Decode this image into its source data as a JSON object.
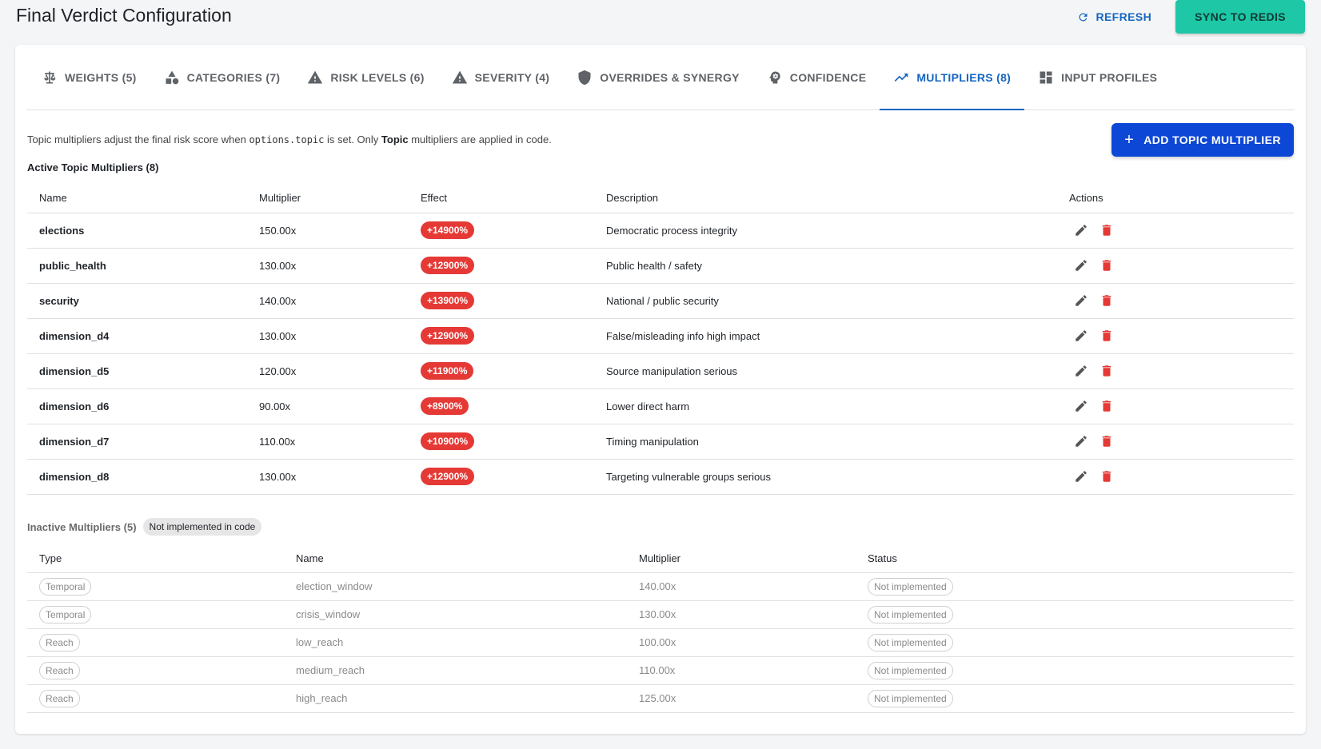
{
  "header": {
    "title": "Final Verdict Configuration",
    "refresh_label": "REFRESH",
    "sync_label": "SYNC TO REDIS"
  },
  "tabs": [
    {
      "label": "WEIGHTS (5)",
      "icon": "scale-icon"
    },
    {
      "label": "CATEGORIES (7)",
      "icon": "shapes-icon"
    },
    {
      "label": "RISK LEVELS (6)",
      "icon": "warning-icon"
    },
    {
      "label": "SEVERITY (4)",
      "icon": "warning-icon"
    },
    {
      "label": "OVERRIDES & SYNERGY",
      "icon": "shield-icon"
    },
    {
      "label": "CONFIDENCE",
      "icon": "brain-icon"
    },
    {
      "label": "MULTIPLIERS (8)",
      "icon": "trending-up-icon",
      "active": true
    },
    {
      "label": "INPUT PROFILES",
      "icon": "dashboard-icon"
    }
  ],
  "intro": {
    "part1": "Topic multipliers adjust the final risk score when ",
    "code": "options.topic",
    "part2": " is set. Only ",
    "bold": "Topic",
    "part3": " multipliers are applied in code."
  },
  "add_button_label": "ADD TOPIC MULTIPLIER",
  "active": {
    "title": "Active Topic Multipliers (8)",
    "columns": [
      "Name",
      "Multiplier",
      "Effect",
      "Description",
      "Actions"
    ],
    "rows": [
      {
        "name": "elections",
        "multiplier": "150.00x",
        "effect": "+14900%",
        "description": "Democratic process integrity"
      },
      {
        "name": "public_health",
        "multiplier": "130.00x",
        "effect": "+12900%",
        "description": "Public health / safety"
      },
      {
        "name": "security",
        "multiplier": "140.00x",
        "effect": "+13900%",
        "description": "National / public security"
      },
      {
        "name": "dimension_d4",
        "multiplier": "130.00x",
        "effect": "+12900%",
        "description": "False/misleading info high impact"
      },
      {
        "name": "dimension_d5",
        "multiplier": "120.00x",
        "effect": "+11900%",
        "description": "Source manipulation serious"
      },
      {
        "name": "dimension_d6",
        "multiplier": "90.00x",
        "effect": "+8900%",
        "description": "Lower direct harm"
      },
      {
        "name": "dimension_d7",
        "multiplier": "110.00x",
        "effect": "+10900%",
        "description": "Timing manipulation"
      },
      {
        "name": "dimension_d8",
        "multiplier": "130.00x",
        "effect": "+12900%",
        "description": "Targeting vulnerable groups serious"
      }
    ]
  },
  "inactive": {
    "title": "Inactive Multipliers (5)",
    "chip": "Not implemented in code",
    "columns": [
      "Type",
      "Name",
      "Multiplier",
      "Status"
    ],
    "rows": [
      {
        "type": "Temporal",
        "name": "election_window",
        "multiplier": "140.00x",
        "status": "Not implemented"
      },
      {
        "type": "Temporal",
        "name": "crisis_window",
        "multiplier": "130.00x",
        "status": "Not implemented"
      },
      {
        "type": "Reach",
        "name": "low_reach",
        "multiplier": "100.00x",
        "status": "Not implemented"
      },
      {
        "type": "Reach",
        "name": "medium_reach",
        "multiplier": "110.00x",
        "status": "Not implemented"
      },
      {
        "type": "Reach",
        "name": "high_reach",
        "multiplier": "125.00x",
        "status": "Not implemented"
      }
    ]
  },
  "colors": {
    "primary": "#1565c0",
    "add_button": "#0d47d6",
    "sync_button": "#1ec7a6",
    "effect_badge": "#e53935",
    "delete_icon": "#e53935",
    "edit_icon": "#555555"
  }
}
